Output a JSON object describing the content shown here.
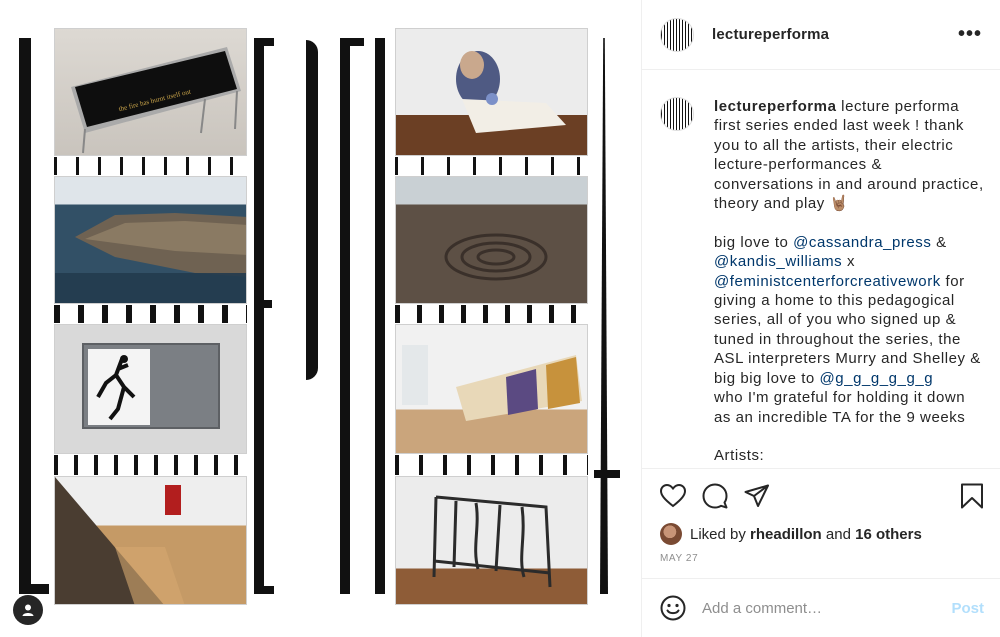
{
  "header": {
    "username": "lectureperforma"
  },
  "caption": {
    "username": "lectureperforma",
    "part1": " lecture performa first series ended last week ! thank you to all the artists, their electric lecture-performances & conversations in and around practice, theory and play 🤘🏽\n\nbig love to ",
    "mention1": "@cassandra_press",
    "part2": " &\n",
    "mention2": "@kandis_williams",
    "part3": " x\n",
    "mention3": "@feministcenterforcreativework",
    "part4": " for giving a home to this pedagogical series, all of you who signed up & tuned in throughout the series, the ASL interpreters Murry and Shelley & big big love to ",
    "mention4": "@g_g_g_g_g_g",
    "part5": "\nwho I'm grateful for holding it down as an incredible TA for the 9 weeks\n\nArtists:"
  },
  "likes": {
    "prefix": "Liked by ",
    "user": "rheadillon",
    "middle": " and ",
    "others": "16 others"
  },
  "date": "MAY 27",
  "comment": {
    "placeholder": "Add a comment…",
    "post_label": "Post"
  },
  "image": {
    "table_text": "the fire has burnt itself out",
    "icons": [
      "like-icon",
      "comment-icon",
      "share-icon",
      "save-icon",
      "emoji-icon",
      "user-icon",
      "more-icon"
    ]
  }
}
